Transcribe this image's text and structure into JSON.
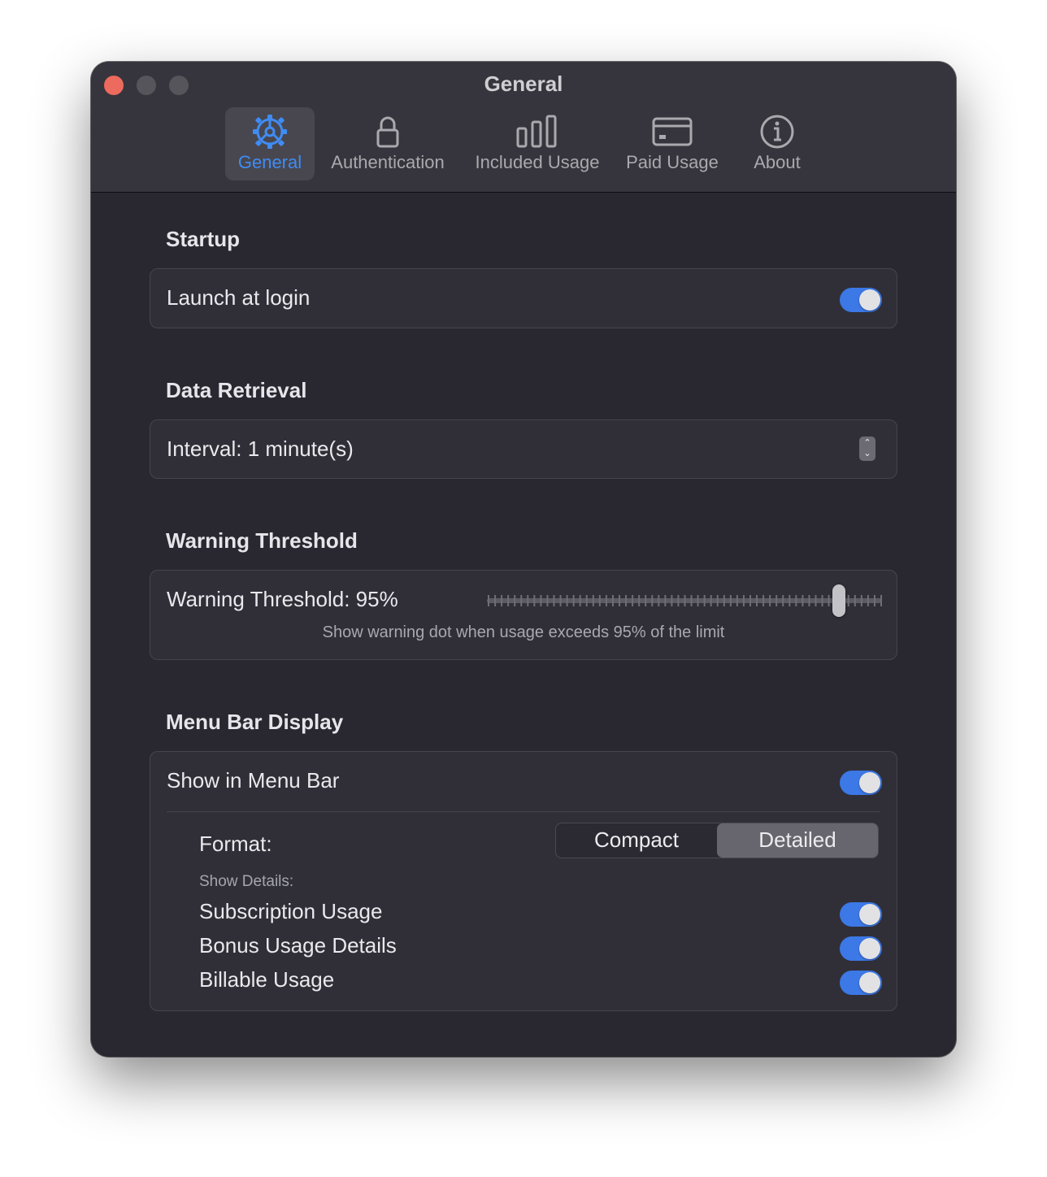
{
  "window": {
    "title": "General",
    "accent_color": "#3f8cf5"
  },
  "tabs": [
    {
      "label": "General",
      "icon": "gear-icon",
      "active": true
    },
    {
      "label": "Authentication",
      "icon": "lock-icon",
      "active": false
    },
    {
      "label": "Included Usage",
      "icon": "bar-chart-icon",
      "active": false
    },
    {
      "label": "Paid Usage",
      "icon": "credit-card-icon",
      "active": false
    },
    {
      "label": "About",
      "icon": "info-icon",
      "active": false
    }
  ],
  "startup": {
    "title": "Startup",
    "launch_label": "Launch at login",
    "launch_on": true
  },
  "data_retrieval": {
    "title": "Data Retrieval",
    "interval_label": "Interval: 1 minute(s)"
  },
  "warning": {
    "title": "Warning Threshold",
    "label": "Warning Threshold: 95%",
    "value_percent": 95,
    "helper": "Show warning dot when usage exceeds 95% of the limit"
  },
  "menu_bar": {
    "title": "Menu Bar Display",
    "show_label": "Show in Menu Bar",
    "show_on": true,
    "format_label": "Format:",
    "format_options": [
      "Compact",
      "Detailed"
    ],
    "format_selected": "Detailed",
    "details_label": "Show Details:",
    "details": [
      {
        "label": "Subscription Usage",
        "on": true
      },
      {
        "label": "Bonus Usage Details",
        "on": true
      },
      {
        "label": "Billable Usage",
        "on": true
      }
    ]
  }
}
